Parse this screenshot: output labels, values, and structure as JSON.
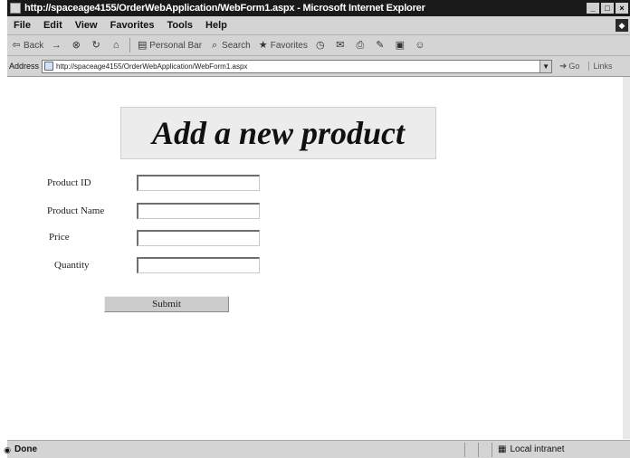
{
  "window": {
    "title": "http://spaceage4155/OrderWebApplication/WebForm1.aspx - Microsoft Internet Explorer",
    "controls": [
      "_",
      "□",
      "×"
    ]
  },
  "menu": [
    "File",
    "Edit",
    "View",
    "Favorites",
    "Tools",
    "Help"
  ],
  "toolbar": {
    "back": "Back",
    "forward": "→",
    "search": "Search",
    "favorites": "Favorites",
    "personal_bar": "Personal Bar"
  },
  "address": {
    "label": "Address",
    "url": "http://spaceage4155/OrderWebApplication/WebForm1.aspx",
    "go": "Go",
    "links": "Links"
  },
  "page": {
    "heading": "Add a new product",
    "fields": [
      {
        "label": "Product ID",
        "value": ""
      },
      {
        "label": "Product Name",
        "value": ""
      },
      {
        "label": "Price",
        "value": ""
      },
      {
        "label": "Quantity",
        "value": ""
      }
    ],
    "submit_label": "Submit"
  },
  "status": {
    "text": "Done",
    "zone": "Local intranet"
  },
  "icons": {
    "app": "ie-page-icon",
    "back": "back-arrow-icon",
    "forward": "forward-arrow-icon",
    "stop": "stop-icon",
    "refresh": "refresh-icon",
    "home": "home-icon",
    "search": "search-icon",
    "favorites": "favorites-icon",
    "history": "history-icon",
    "mail": "mail-icon",
    "print": "print-icon",
    "edit": "edit-icon",
    "discuss": "discuss-icon",
    "messenger": "messenger-icon",
    "go": "go-arrow-icon",
    "status": "page-done-icon",
    "zone": "intranet-icon"
  }
}
